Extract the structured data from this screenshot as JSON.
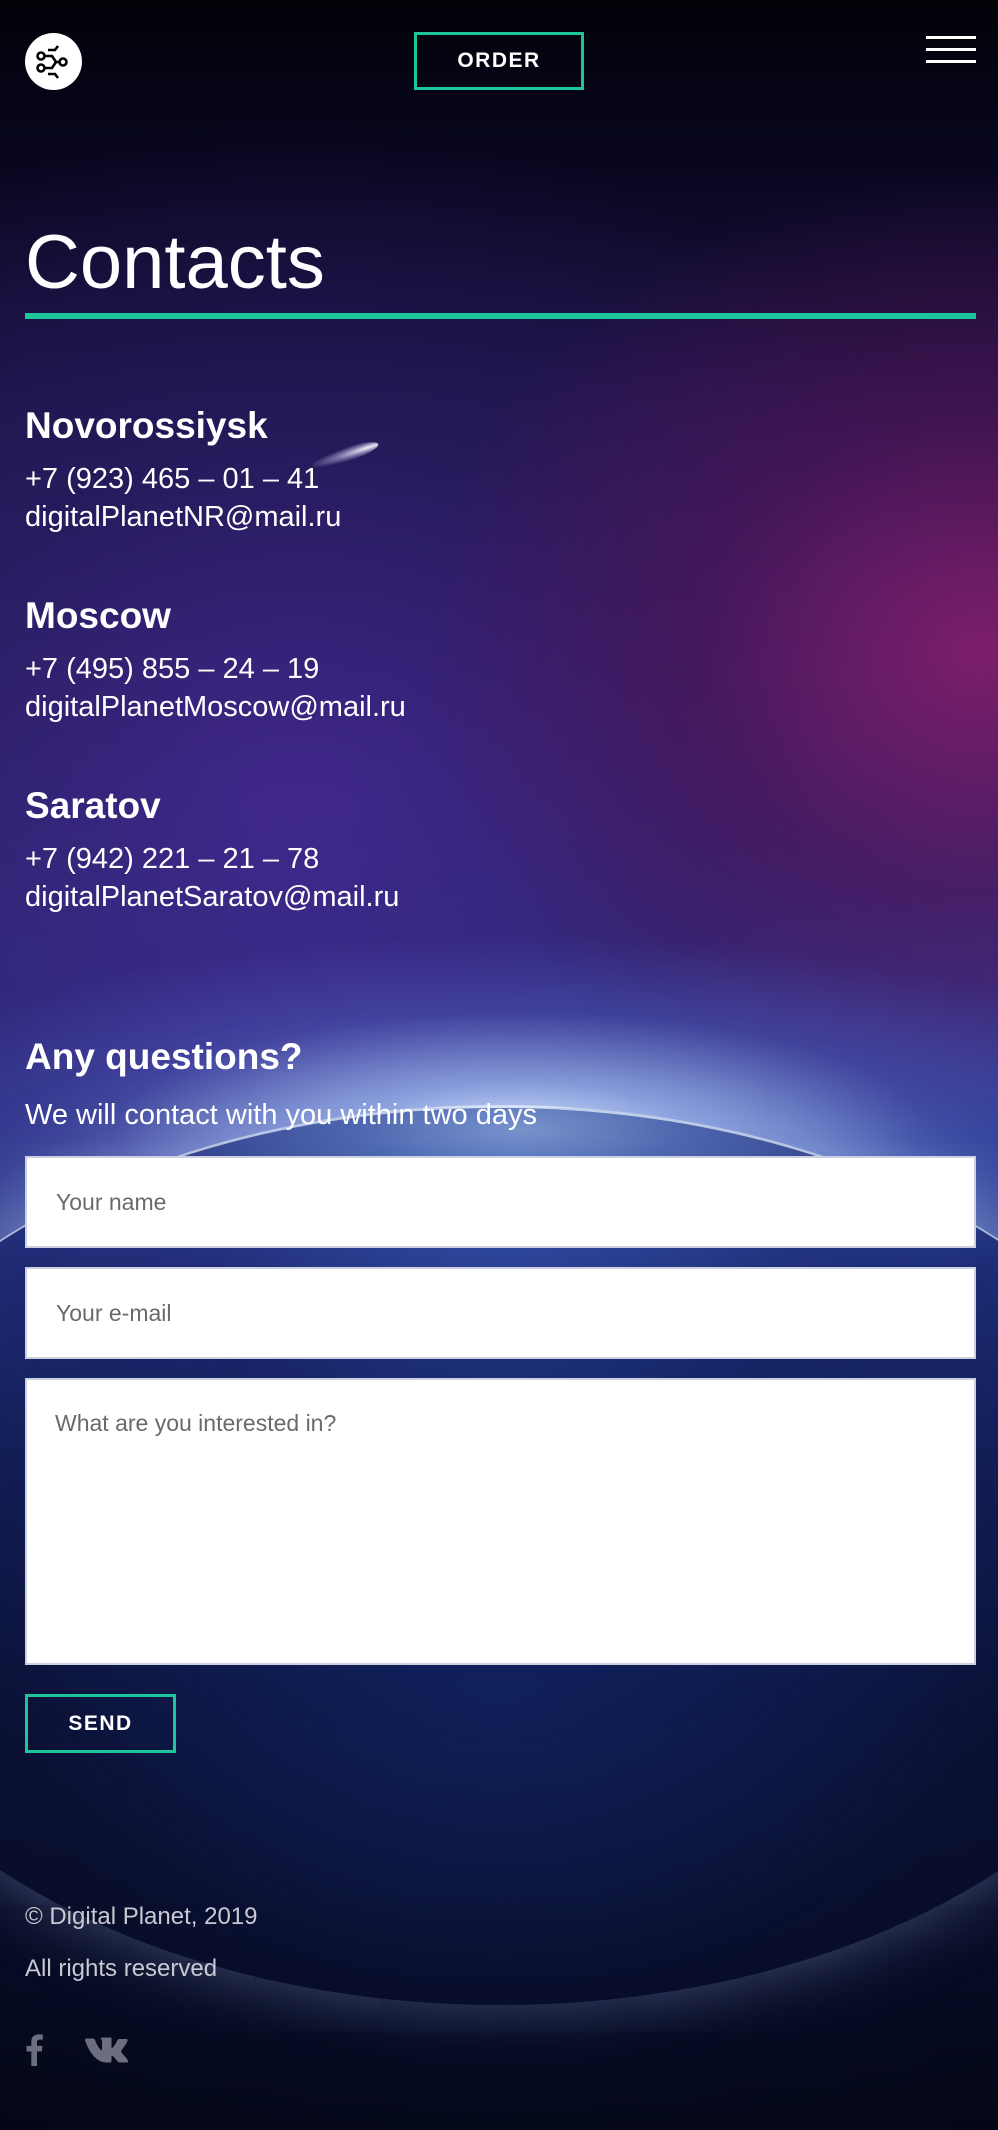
{
  "header": {
    "logo_icon": "digital-planet-logo-icon",
    "order_label": "ORDER",
    "menu_icon": "hamburger-menu-icon"
  },
  "page": {
    "title": "Contacts",
    "accent_color": "#1fc59a"
  },
  "offices": [
    {
      "city": "Novorossiysk",
      "phone": "+7 (923) 465 – 01 – 41",
      "email": "digitalPlanetNR@mail.ru"
    },
    {
      "city": "Moscow",
      "phone": "+7 (495) 855 – 24 – 19",
      "email": "digitalPlanetMoscow@mail.ru"
    },
    {
      "city": "Saratov",
      "phone": "+7 (942) 221 – 21 – 78",
      "email": "digitalPlanetSaratov@mail.ru"
    }
  ],
  "form": {
    "title": "Any questions?",
    "subtitle": "We will contact with you within two days",
    "name_placeholder": "Your name",
    "email_placeholder": "Your e-mail",
    "message_placeholder": "What are you interested in?",
    "send_label": "SEND"
  },
  "footer": {
    "copyright": "© Digital Planet, 2019",
    "rights": "All rights reserved",
    "social_icons": [
      "facebook-icon",
      "vk-icon"
    ]
  }
}
